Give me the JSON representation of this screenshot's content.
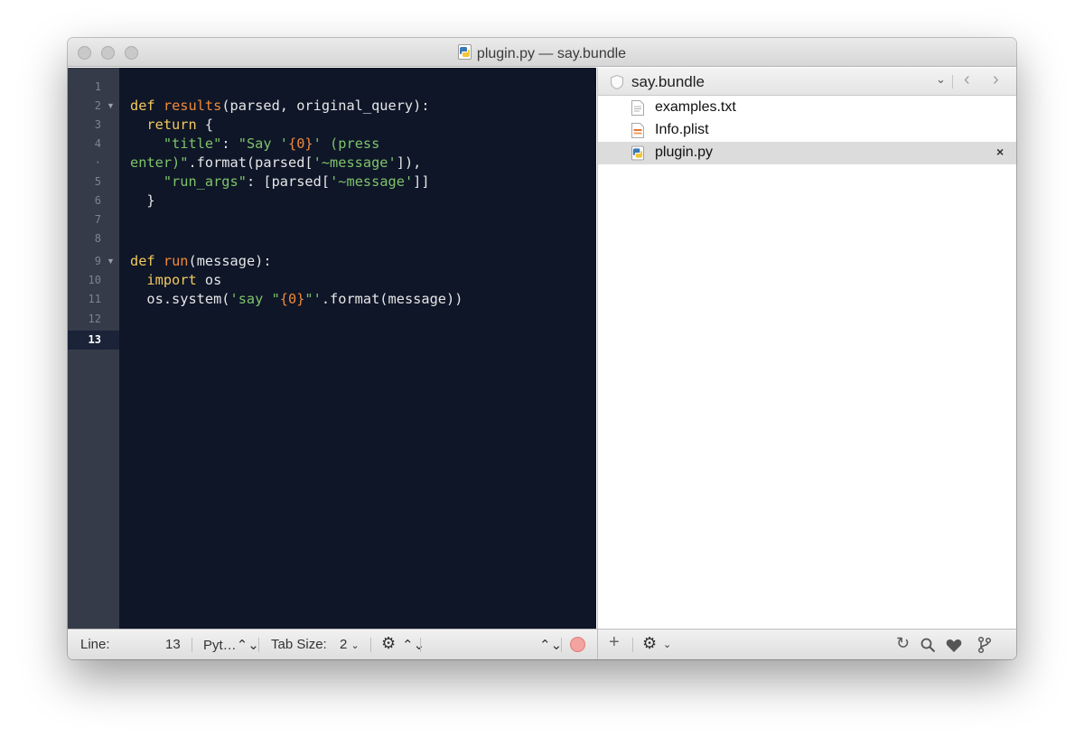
{
  "window": {
    "title": "plugin.py — say.bundle",
    "title_icon": "python-file-icon"
  },
  "editor": {
    "language": "Python",
    "current_line": 13,
    "gutter_lines": [
      "1",
      "2",
      "3",
      "4",
      "·",
      "5",
      "6",
      "7",
      "8",
      "9",
      "10",
      "11",
      "12",
      "13"
    ],
    "folded_lines": [
      "2",
      "9"
    ],
    "code_lines": [
      "",
      "def results(parsed, original_query):",
      "  return {",
      "    \"title\": \"Say '{0}' (press",
      "enter)\".format(parsed['~message']),",
      "    \"run_args\": [parsed['~message']]",
      "  }",
      "",
      "",
      "def run(message):",
      "  import os",
      "  os.system('say \"{0}\"'.format(message))",
      "",
      ""
    ],
    "colors": {
      "background": "#0e1628",
      "gutter": "#353b48",
      "keyword": "#f4c95d",
      "function": "#f08a3a",
      "string": "#7fc36a"
    }
  },
  "project": {
    "name": "say.bundle",
    "files": [
      {
        "name": "examples.txt",
        "icon": "text-file-icon",
        "selected": false
      },
      {
        "name": "Info.plist",
        "icon": "plist-file-icon",
        "selected": false
      },
      {
        "name": "plugin.py",
        "icon": "python-file-icon",
        "selected": true
      }
    ]
  },
  "statusbar": {
    "line_label": "Line:",
    "line_value": "13",
    "syntax": "Pyt…",
    "tab_size_label": "Tab Size:",
    "tab_size_value": "2"
  }
}
